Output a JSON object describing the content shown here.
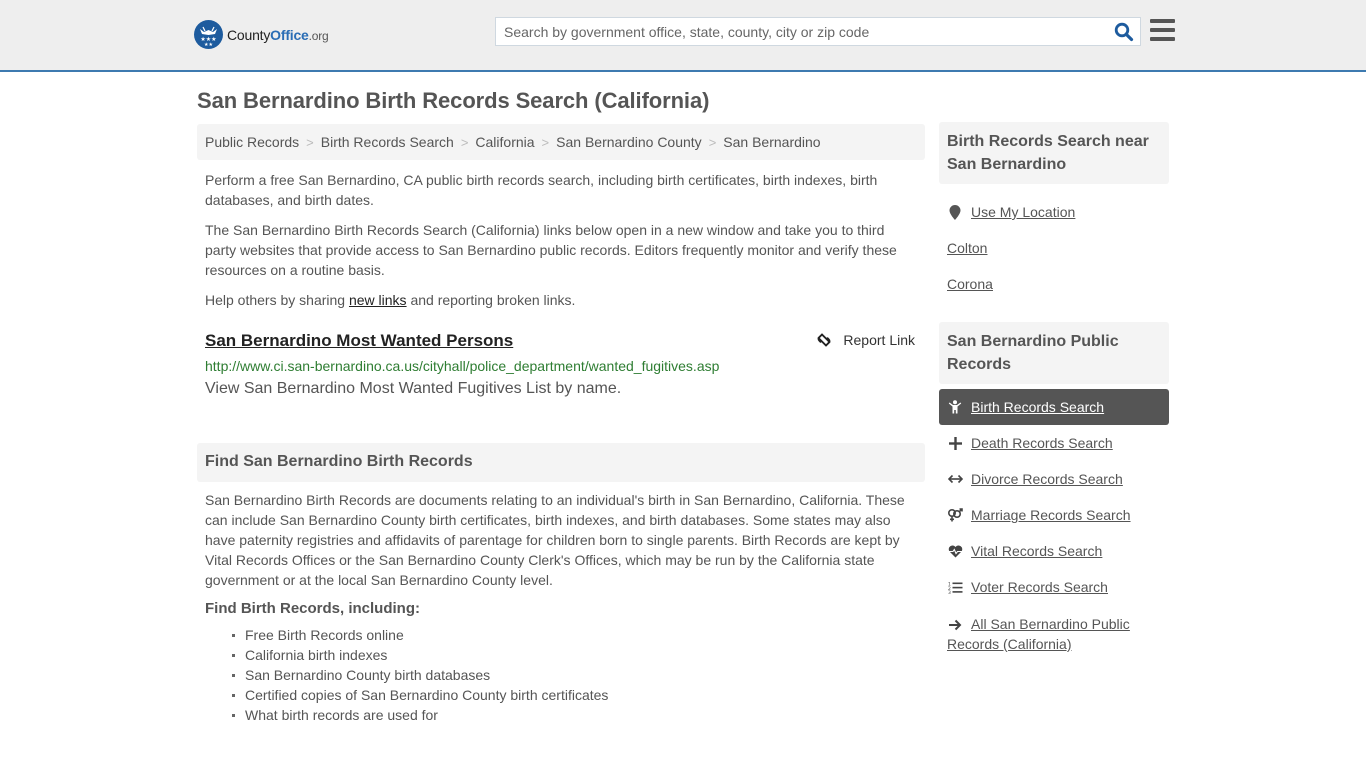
{
  "header": {
    "logo": {
      "name_part1": "County",
      "name_part2": "Office",
      "name_part3": ".org"
    },
    "search": {
      "placeholder": "Search by government office, state, county, city or zip code",
      "value": ""
    },
    "search_icon": "magnifier-icon",
    "menu_icon": "hamburger-icon",
    "colors": {
      "accent": "#3d7ab0",
      "logo_blue": "#1d5b9e",
      "search_icon": "#1d5b9e"
    }
  },
  "page": {
    "title": "San Bernardino Birth Records Search (California)"
  },
  "breadcrumb": [
    {
      "label": "Public Records"
    },
    {
      "label": "Birth Records Search"
    },
    {
      "label": "California"
    },
    {
      "label": "San Bernardino County"
    },
    {
      "label": "San Bernardino"
    }
  ],
  "intro": {
    "p1": "Perform a free San Bernardino, CA public birth records search, including birth certificates, birth indexes, birth databases, and birth dates.",
    "p2": "The San Bernardino Birth Records Search (California) links below open in a new window and take you to third party websites that provide access to San Bernardino public records. Editors frequently monitor and verify these resources on a routine basis.",
    "p3_before": "Help others by sharing ",
    "p3_link": "new links",
    "p3_after": " and reporting broken links."
  },
  "results": [
    {
      "title": "San Bernardino Most Wanted Persons",
      "url": "http://www.ci.san-bernardino.ca.us/cityhall/police_department/wanted_fugitives.asp",
      "description": "View San Bernardino Most Wanted Fugitives List by name.",
      "report_label": "Report Link"
    }
  ],
  "find_section": {
    "heading": "Find San Bernardino Birth Records",
    "body": "San Bernardino Birth Records are documents relating to an individual's birth in San Bernardino, California. These can include San Bernardino County birth certificates, birth indexes, and birth databases. Some states may also have paternity registries and affidavits of parentage for children born to single parents. Birth Records are kept by Vital Records Offices or the San Bernardino County Clerk's Offices, which may be run by the California state government or at the local San Bernardino County level.",
    "sub_heading": "Find Birth Records, including:",
    "bullets": [
      "Free Birth Records online",
      "California birth indexes",
      "San Bernardino County birth databases",
      "Certified copies of San Bernardino County birth certificates",
      "What birth records are used for"
    ]
  },
  "sidebar": {
    "near_heading": "Birth Records Search near San Bernardino",
    "near_links": [
      {
        "label": "Use My Location",
        "icon": "map-pin-icon"
      },
      {
        "label": "Colton"
      },
      {
        "label": "Corona"
      }
    ],
    "records_heading": "San Bernardino Public Records",
    "records_links": [
      {
        "label": "Birth Records Search",
        "icon": "child-icon",
        "active": true
      },
      {
        "label": "Death Records Search",
        "icon": "cross-icon"
      },
      {
        "label": "Divorce Records Search",
        "icon": "arrows-horizontal-icon"
      },
      {
        "label": "Marriage Records Search",
        "icon": "venus-mars-icon"
      },
      {
        "label": "Vital Records Search",
        "icon": "heartbeat-icon"
      },
      {
        "label": "Voter Records Search",
        "icon": "list-ordered-icon"
      },
      {
        "label": "All San Bernardino Public Records (California)",
        "icon": "arrow-right-icon"
      }
    ]
  }
}
